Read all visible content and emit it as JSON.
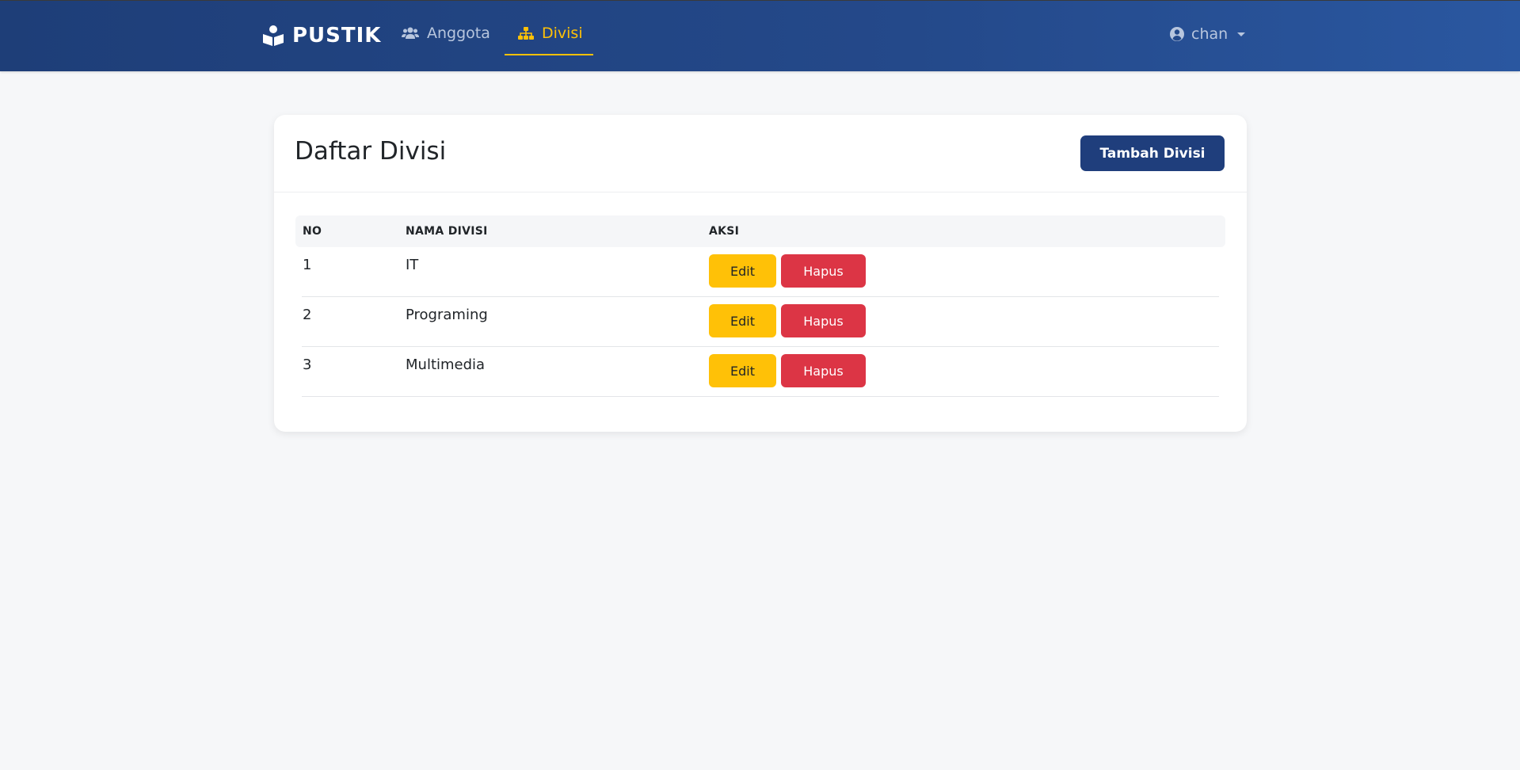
{
  "navbar": {
    "brand": "PUSTIK",
    "links": [
      {
        "label": "Anggota",
        "icon": "users-icon",
        "active": false
      },
      {
        "label": "Divisi",
        "icon": "sitemap-icon",
        "active": true
      }
    ],
    "user": {
      "name": "chan",
      "icon": "user-circle-icon"
    }
  },
  "colors": {
    "navbar": "#1e3e78",
    "accent": "#ffc107",
    "danger": "#dc3545",
    "primary_button": "#1f3e7c"
  },
  "page": {
    "title": "Daftar Divisi",
    "add_button": "Tambah Divisi"
  },
  "table": {
    "headers": [
      "NO",
      "NAMA DIVISI",
      "AKSI"
    ],
    "rows": [
      {
        "no": "1",
        "name": "IT",
        "edit": "Edit",
        "delete": "Hapus"
      },
      {
        "no": "2",
        "name": "Programing",
        "edit": "Edit",
        "delete": "Hapus"
      },
      {
        "no": "3",
        "name": "Multimedia",
        "edit": "Edit",
        "delete": "Hapus"
      }
    ]
  }
}
